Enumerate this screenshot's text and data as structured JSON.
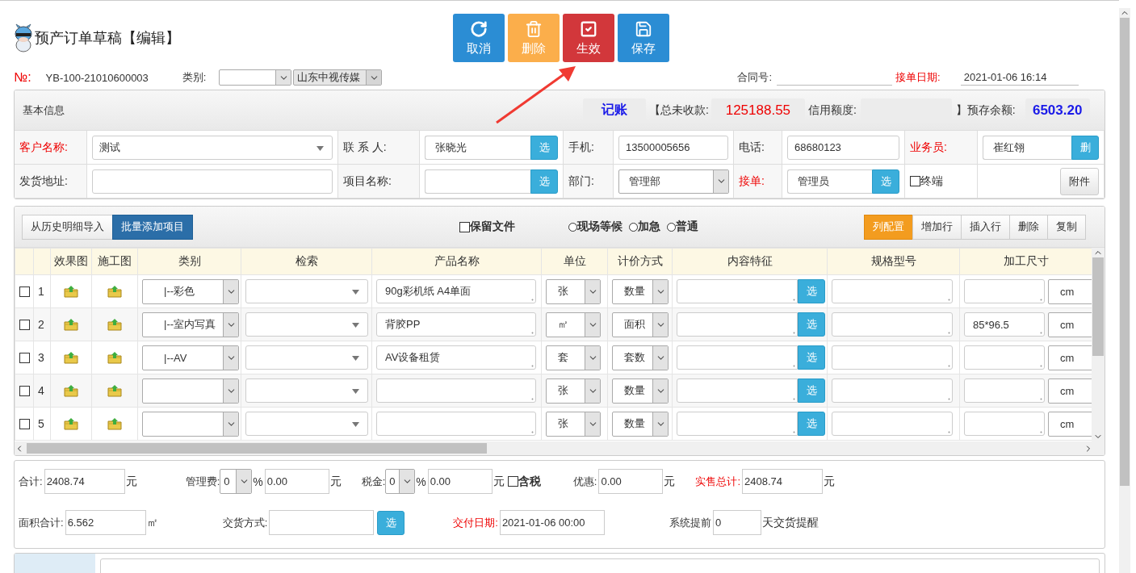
{
  "header": {
    "title": "预产订单草稿【编辑】"
  },
  "actions": [
    {
      "label": "取消",
      "kind": "undo"
    },
    {
      "label": "删除",
      "kind": "trash"
    },
    {
      "label": "生效",
      "kind": "check"
    },
    {
      "label": "保存",
      "kind": "save"
    }
  ],
  "order_line": {
    "no_label": "№:",
    "no": "YB-100-21010600003",
    "category_label": "类别:",
    "company": "山东中视传媒",
    "contract_label": "合同号:",
    "date_label": "接单日期:",
    "date": "2021-01-06 16:14"
  },
  "basic_info": {
    "title": "基本信息",
    "account": "记账",
    "unpaid_label": "【总未收款:",
    "unpaid": "125188.55",
    "credit_label": "信用额度:",
    "balance_label": "】预存余额:",
    "balance": "6503.20",
    "rows": [
      [
        {
          "kind": "label",
          "text": "客户名称:",
          "required": true
        },
        {
          "kind": "combo",
          "value": "测试"
        },
        {
          "kind": "label",
          "text": "联 系 人:",
          "required": false
        },
        {
          "kind": "pick",
          "value": "张晓光",
          "button": "选"
        },
        {
          "kind": "label",
          "text": "手机:",
          "required": false
        },
        {
          "kind": "text",
          "value": "13500005656"
        },
        {
          "kind": "label",
          "text": "电话:",
          "required": false
        },
        {
          "kind": "text",
          "value": "68680123"
        },
        {
          "kind": "label",
          "text": "业务员:",
          "required": true
        },
        {
          "kind": "pick",
          "value": "崔红翎",
          "button": "删"
        }
      ],
      [
        {
          "kind": "label",
          "text": "发货地址:",
          "required": false
        },
        {
          "kind": "text"
        },
        {
          "kind": "label",
          "text": "项目名称:",
          "required": false
        },
        {
          "kind": "pick",
          "button": "选"
        },
        {
          "kind": "label",
          "text": "部门:",
          "required": false
        },
        {
          "kind": "select",
          "value": "管理部"
        },
        {
          "kind": "label",
          "text": "接单:",
          "required": true
        },
        {
          "kind": "pick",
          "value": "管理员",
          "button": "选"
        },
        {
          "kind": "check",
          "text": "终端",
          "checked": false
        },
        {
          "kind": "button",
          "text": "附件"
        }
      ]
    ]
  },
  "items": {
    "left_buttons": [
      {
        "label": "从历史明细导入",
        "kind": "default"
      },
      {
        "label": "批量添加项目",
        "kind": "primary"
      }
    ],
    "keep_files": {
      "label": "保留文件",
      "checked": false
    },
    "priority": [
      {
        "label": "现场等候",
        "selected": false
      },
      {
        "label": "加急",
        "selected": false
      },
      {
        "label": "普通",
        "selected": false
      }
    ],
    "right_buttons": [
      {
        "label": "列配置",
        "kind": "warning"
      },
      {
        "label": "增加行",
        "kind": "default"
      },
      {
        "label": "插入行",
        "kind": "default"
      },
      {
        "label": "删除",
        "kind": "default"
      },
      {
        "label": "复制",
        "kind": "default"
      }
    ],
    "columns": [
      "效果图",
      "施工图",
      "类别",
      "检索",
      "产品名称",
      "单位",
      "计价方式",
      "内容特征",
      "规格型号",
      "加工尺寸"
    ],
    "rows": [
      {
        "checked": false,
        "number": "1",
        "category": "|--彩色",
        "product": "90g彩机纸 A4单面",
        "unit": "张",
        "pricing": "数量",
        "feature_button": "选",
        "size_unit": "cm"
      },
      {
        "checked": false,
        "number": "2",
        "category": "|--室内写真",
        "product": "背胶PP",
        "unit": "㎡",
        "pricing": "面积",
        "feature_button": "选",
        "size": "85*96.5",
        "size_unit": "cm"
      },
      {
        "checked": false,
        "number": "3",
        "category": "|--AV",
        "product": "AV设备租赁",
        "unit": "套",
        "pricing": "套数",
        "feature_button": "选",
        "size_unit": "cm"
      },
      {
        "checked": false,
        "number": "4",
        "unit": "张",
        "pricing": "数量",
        "feature_button": "选",
        "size_unit": "cm"
      },
      {
        "checked": false,
        "number": "5",
        "unit": "张",
        "pricing": "数量",
        "feature_button": "选",
        "size_unit": "cm"
      }
    ]
  },
  "totals": {
    "summary": [
      {
        "kind": "label",
        "text": "合计:",
        "required": false
      },
      {
        "kind": "input",
        "value": "2408.74"
      },
      {
        "kind": "unit",
        "text": "元"
      },
      {
        "kind": "label",
        "text": "管理费:",
        "required": false
      },
      {
        "kind": "select",
        "value": "0"
      },
      {
        "kind": "unit",
        "text": "%"
      },
      {
        "kind": "input",
        "value": "0.00"
      },
      {
        "kind": "unit",
        "text": "元"
      },
      {
        "kind": "label",
        "text": "税金:",
        "required": false
      },
      {
        "kind": "select",
        "value": "0"
      },
      {
        "kind": "unit",
        "text": "%"
      },
      {
        "kind": "input",
        "value": "0.00"
      },
      {
        "kind": "unit",
        "text": "元"
      },
      {
        "kind": "check",
        "text": "含税",
        "checked": false
      },
      {
        "kind": "label",
        "text": "优惠:",
        "required": false
      },
      {
        "kind": "input",
        "value": "0.00"
      },
      {
        "kind": "unit",
        "text": "元"
      },
      {
        "kind": "label",
        "text": "实售总计:",
        "required": true
      },
      {
        "kind": "input",
        "value": "2408.74"
      },
      {
        "kind": "unit",
        "text": "元"
      }
    ],
    "delivery": [
      {
        "kind": "label",
        "text": "面积合计:",
        "required": false
      },
      {
        "kind": "input",
        "value": "6.562"
      },
      {
        "kind": "unit",
        "text": "㎡"
      },
      {
        "kind": "label",
        "text": "交货方式:",
        "required": false
      },
      {
        "kind": "input"
      },
      {
        "kind": "button",
        "text": "选"
      },
      {
        "kind": "label",
        "text": "交付日期:",
        "required": true
      },
      {
        "kind": "input",
        "value": "2021-01-06 00:00"
      },
      {
        "kind": "label",
        "text": "系统提前",
        "required": false
      },
      {
        "kind": "input",
        "value": "0"
      },
      {
        "kind": "unit",
        "text": "天交货提醒"
      }
    ]
  }
}
